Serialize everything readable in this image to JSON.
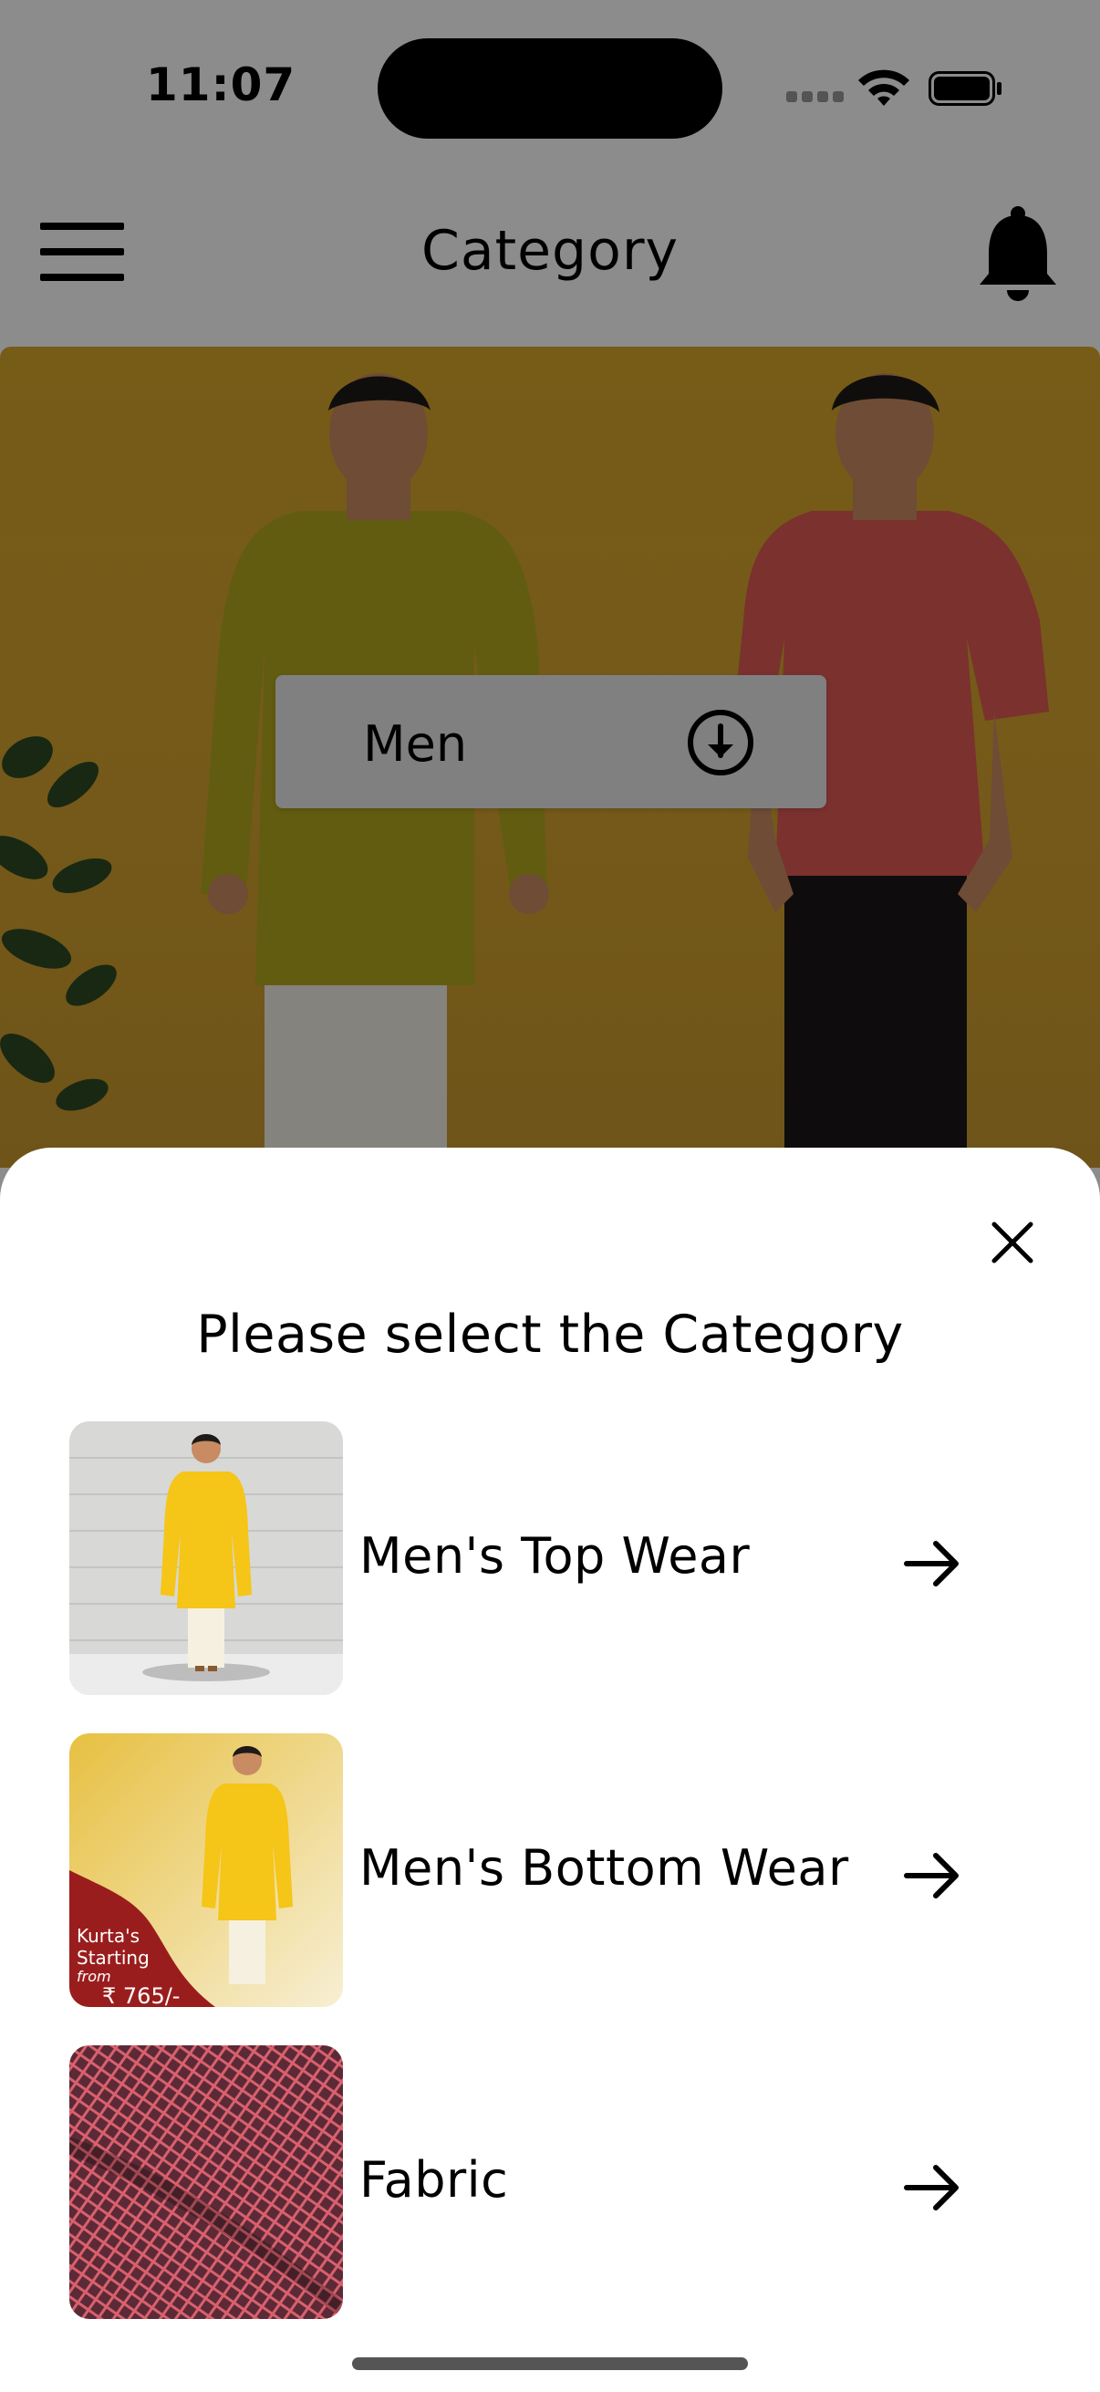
{
  "status_bar": {
    "time": "11:07"
  },
  "header": {
    "title": "Category"
  },
  "hero": {
    "dropdown_value": "Men"
  },
  "sheet": {
    "title": "Please select the Category",
    "categories": [
      {
        "label": "Men's Top Wear"
      },
      {
        "label": "Men's Bottom Wear",
        "promo": {
          "line1": "Kurta's",
          "line2": "Starting",
          "line3": "from",
          "price": "₹ 765/-"
        }
      },
      {
        "label": "Fabric"
      }
    ]
  },
  "icons": {
    "menu": "hamburger-icon",
    "notifications": "bell-icon",
    "dropdown": "circle-arrow-down-icon",
    "close": "close-icon",
    "row": "arrow-right-icon"
  },
  "colors": {
    "hero_background": "#d5a330",
    "overlay": "rgba(0,0,0,0.45)",
    "sheet": "#ffffff"
  }
}
